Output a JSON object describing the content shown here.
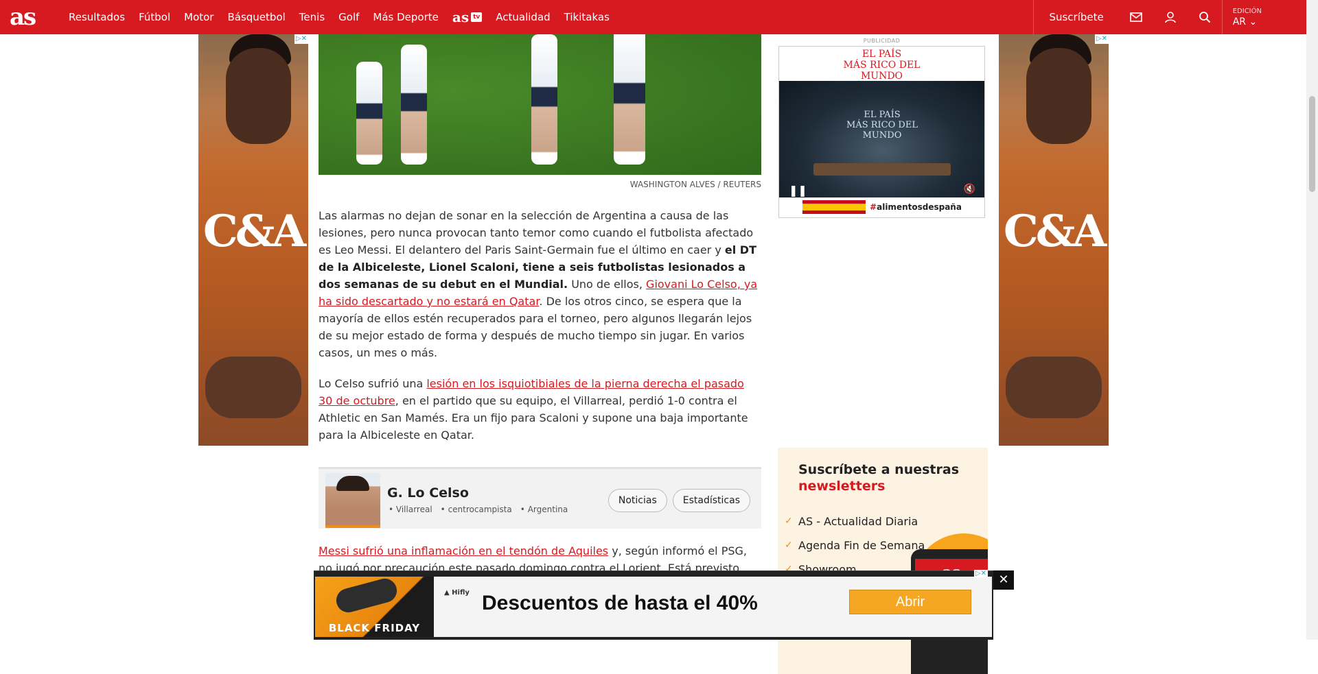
{
  "header": {
    "logo": "as",
    "nav": [
      "Resultados",
      "Fútbol",
      "Motor",
      "Básquetbol",
      "Tenis",
      "Golf",
      "Más Deporte"
    ],
    "nav_tv_logo": "as",
    "nav_tv_badge": "tv",
    "nav_after": [
      "Actualidad",
      "Tikitakas"
    ],
    "subscribe": "Suscríbete",
    "edition_label": "EDICIÓN",
    "edition_value": "AR ⌄"
  },
  "side_ads": {
    "brand": "C&A",
    "choices": "▷✕"
  },
  "article": {
    "photo_credit": "WASHINGTON ALVES / REUTERS",
    "p1_a": "Las alarmas no dejan de sonar en la selección de Argentina a causa de las lesiones, pero nunca provocan tanto temor como cuando el futbolista afectado es Leo Messi. El delantero del Paris Saint-Germain fue el último en caer y ",
    "p1_bold": "el DT de la Albiceleste, Lionel Scaloni, tiene a seis futbolistas lesionados a dos semanas de su debut en el Mundial.",
    "p1_b": " Uno de ellos, ",
    "p1_link": "Giovani Lo Celso, ya ha sido descartado y no estará en Qatar",
    "p1_c": ". De los otros cinco, se espera que la mayoría de ellos estén recuperados para el torneo, pero algunos llegarán lejos de su mejor estado de forma y después de mucho tiempo sin jugar. En varios casos, un mes o más.",
    "p2_a": "Lo Celso sufrió una ",
    "p2_link": "lesión en los isquiotibiales de la pierna derecha el pasado 30 de octubre",
    "p2_b": ", en el partido que su equipo, el Villarreal, perdió 1-0 contra el Athletic en San Mamés. Era un fijo para Scaloni y supone una baja importante para la Albiceleste en Qatar.",
    "p3_link": "Messi sufrió una inflamación en el tendón de Aquiles",
    "p3_a": " y, según informó el PSG, no jugó por precaución este pasado domingo contra el Lorient. Está previsto que regrese a los entrenamientos con sus compañeros este mismo jueves, pero se desconoce si jugará"
  },
  "player_card": {
    "name": "G. Lo Celso",
    "club": "Villarreal",
    "position": "centrocampista",
    "country": "Argentina",
    "btn_news": "Noticias",
    "btn_stats": "Estadísticas"
  },
  "rail": {
    "pub_label": "PUBLICIDAD",
    "ad_head": "EL PAÍS\nMÁS RICO DEL\nMUNDO",
    "ad_video_title": "EL PAÍS\nMÁS RICO DEL\nMUNDO",
    "ad_footer_text": "alimentosdespaña",
    "newsletter_title": "Suscríbete a nuestras",
    "newsletter_title_red": "newsletters",
    "newsletter_items": [
      "AS - Actualidad Diaria",
      "Agenda Fin de Semana",
      "Showroom"
    ],
    "phone_logo": "as"
  },
  "bottom_ad": {
    "promo": "BLACK FRIDAY",
    "brand": "Hifly",
    "headline": "Descuentos de hasta el 40%",
    "cta": "Abrir",
    "choices": "▷✕",
    "close": "✕"
  }
}
